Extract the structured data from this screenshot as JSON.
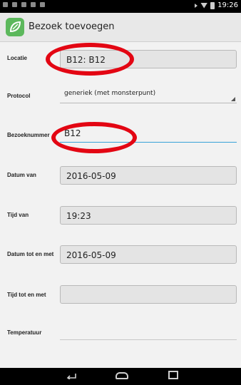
{
  "status_bar": {
    "time": "19:26"
  },
  "app": {
    "title": "Bezoek toevoegen"
  },
  "form": {
    "locatie_label": "Locatie",
    "locatie_value": "B12: B12",
    "protocol_label": "Protocol",
    "protocol_value": "generiek (met monsterpunt)",
    "bezoeknummer_label": "Bezoeknummer",
    "bezoeknummer_value": "B12",
    "datum_van_label": "Datum van",
    "datum_van_value": "2016-05-09",
    "tijd_van_label": "Tijd van",
    "tijd_van_value": "19:23",
    "datum_tot_label": "Datum tot en met",
    "datum_tot_value": "2016-05-09",
    "tijd_tot_label": "Tijd tot en met",
    "tijd_tot_value": "",
    "temperatuur_label": "Temperatuur",
    "temperatuur_value": ""
  },
  "annotations": {
    "color": "#e30613"
  },
  "colors": {
    "accent": "#37a1d8",
    "logo": "#5cb85c"
  }
}
